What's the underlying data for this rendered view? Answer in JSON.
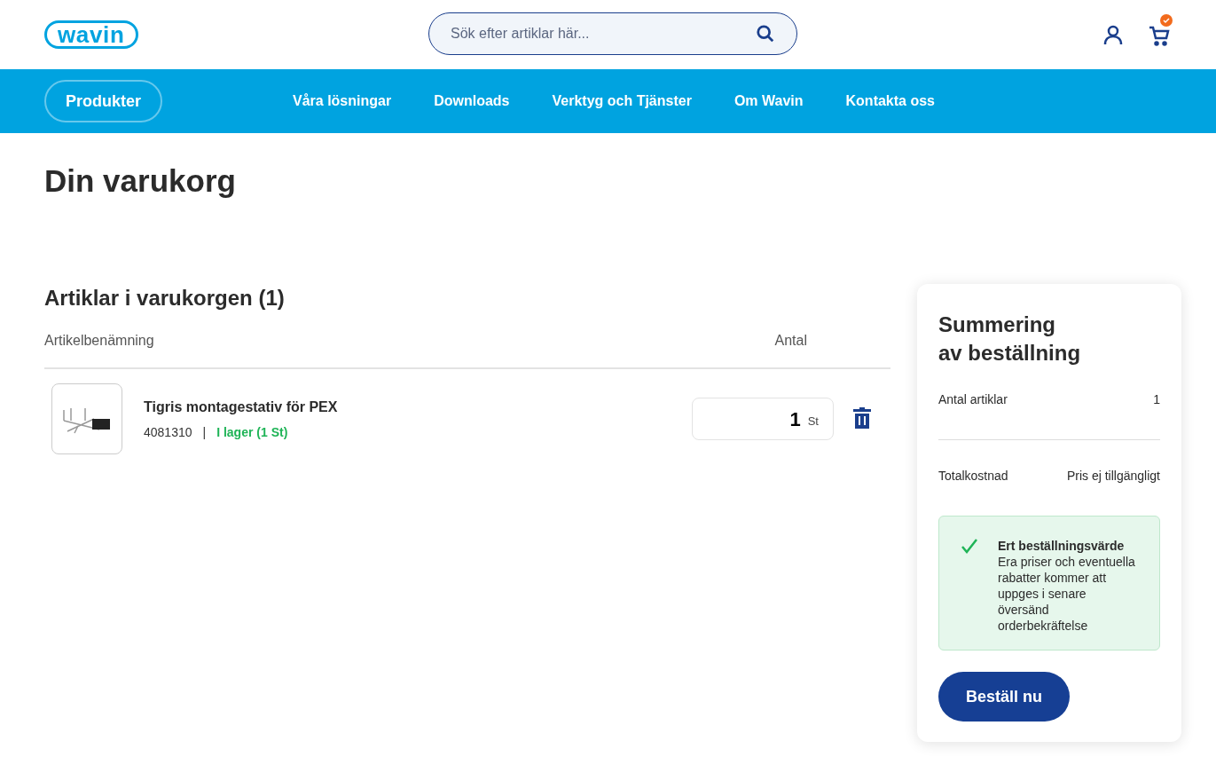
{
  "header": {
    "logo": "wavin",
    "search": {
      "placeholder": "Sök efter artiklar här..."
    },
    "cart_badge": true
  },
  "nav": {
    "button": "Produkter",
    "links": [
      "Våra lösningar",
      "Downloads",
      "Verktyg och Tjänster",
      "Om Wavin",
      "Kontakta oss"
    ]
  },
  "page_title": "Din varukorg",
  "cart": {
    "heading": "Artiklar i varukorgen (1)",
    "columns": [
      "Artikelbenämning",
      "Antal"
    ],
    "items": [
      {
        "name": "Tigris montagestativ för PEX",
        "article_number": "4081310",
        "separator": "|",
        "stock": "I lager (1 St)",
        "in_stock": true,
        "quantity": "1",
        "unit": "St"
      }
    ]
  },
  "summary": {
    "title": "Summering\nav beställning",
    "rows": [
      {
        "label": "Antal artiklar",
        "value": "1"
      },
      {
        "label": "Totalkostnad",
        "value": "Pris ej tillgängligt"
      }
    ],
    "notice": {
      "title": "Ert beställningsvärde",
      "text": "Era priser och eventuella rabatter kommer att uppges i senare översänd orderbekräftelse"
    },
    "button": "Beställ nu"
  }
}
